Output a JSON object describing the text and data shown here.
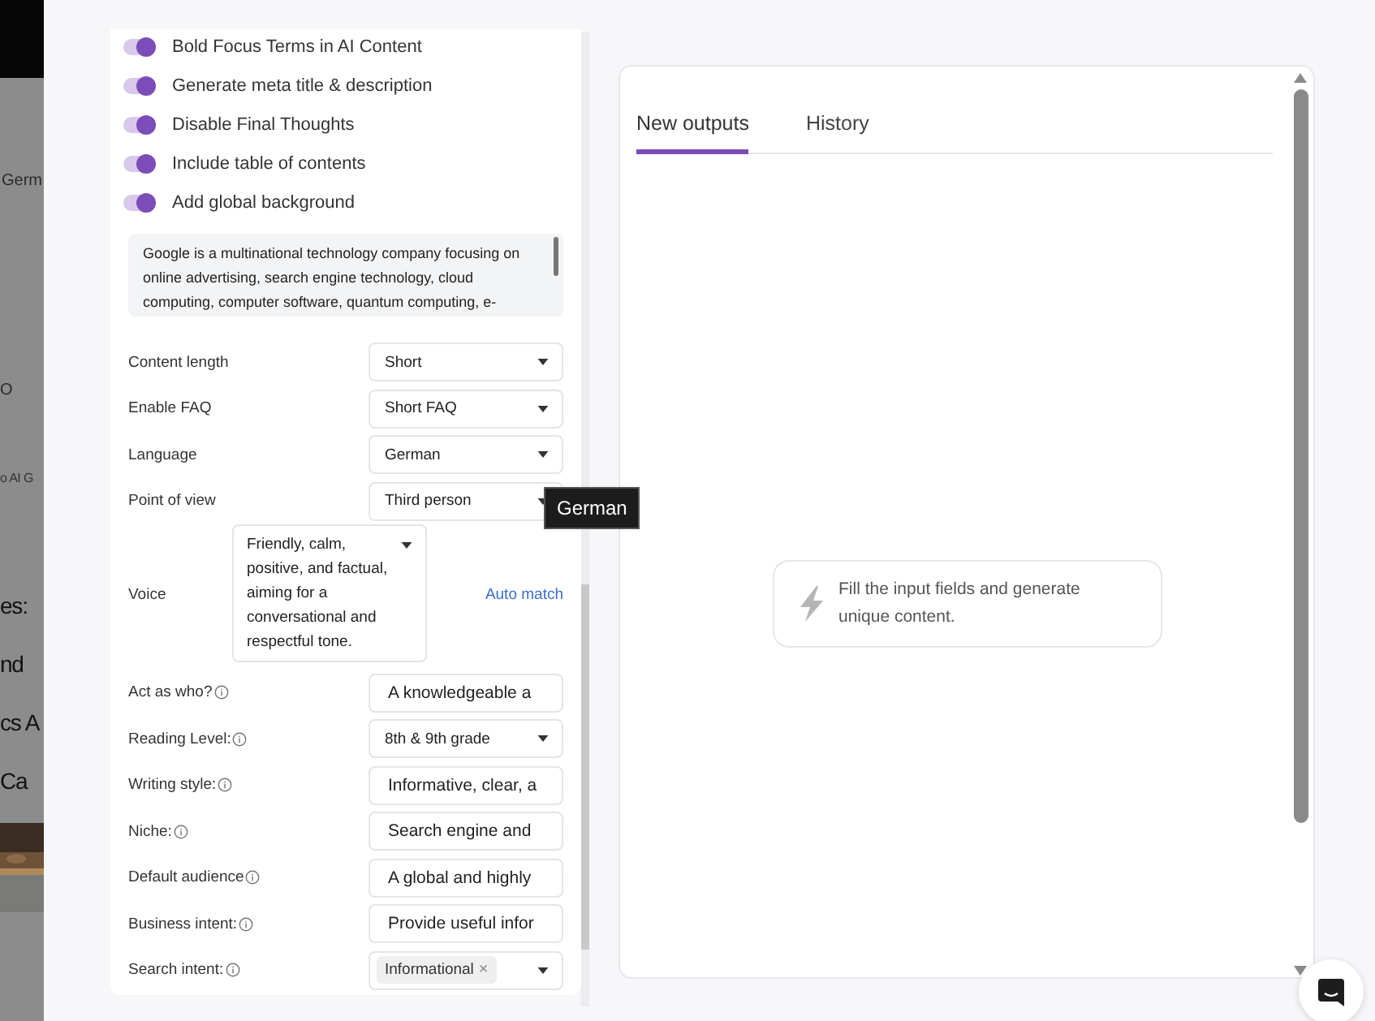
{
  "background_page": {
    "fragments": [
      {
        "kind": "tab",
        "text": "Germ"
      },
      {
        "kind": "icon-text",
        "text": "O"
      },
      {
        "kind": "crumb",
        "text": "o AI G"
      },
      {
        "kind": "heading",
        "text": "es:"
      },
      {
        "kind": "heading",
        "text": "nd"
      },
      {
        "kind": "heading",
        "text": "cs A"
      },
      {
        "kind": "heading",
        "text": "Ca"
      }
    ]
  },
  "settings": {
    "toggles": [
      {
        "label": "Bold Focus Terms in AI Content",
        "on": true
      },
      {
        "label": "Generate meta title & description",
        "on": true
      },
      {
        "label": "Disable Final Thoughts",
        "on": true
      },
      {
        "label": "Include table of contents",
        "on": true
      },
      {
        "label": "Add global background",
        "on": true
      }
    ],
    "background_text": "Google is a multinational technology company focusing on online advertising, search engine technology, cloud computing, computer software, quantum computing, e-",
    "fields": [
      {
        "kind": "select",
        "label": "Content length",
        "info": false,
        "value": "Short"
      },
      {
        "kind": "select",
        "label": "Enable FAQ",
        "info": false,
        "value": "Short FAQ"
      },
      {
        "kind": "select",
        "label": "Language",
        "info": false,
        "value": "German"
      },
      {
        "kind": "select",
        "label": "Point of view",
        "info": false,
        "value": "Third person"
      },
      {
        "kind": "voice",
        "label": "Voice",
        "info": false,
        "value": "Friendly, calm, positive, and factual, aiming for a conversational and respectful tone.",
        "link": "Auto match"
      },
      {
        "kind": "input",
        "label": "Act as who?",
        "info": true,
        "value": "A knowledgeable a"
      },
      {
        "kind": "select",
        "label": "Reading Level:",
        "info": true,
        "value": "8th & 9th grade"
      },
      {
        "kind": "input",
        "label": "Writing style:",
        "info": true,
        "value": "Informative, clear, a"
      },
      {
        "kind": "input",
        "label": "Niche:",
        "info": true,
        "value": "Search engine and"
      },
      {
        "kind": "input",
        "label": "Default audience",
        "info": true,
        "value": "A global and highly"
      },
      {
        "kind": "input",
        "label": "Business intent:",
        "info": true,
        "value": "Provide useful infor"
      },
      {
        "kind": "tags",
        "label": "Search intent:",
        "info": true,
        "tags": [
          "Informational"
        ],
        "remove": "×"
      }
    ]
  },
  "tooltip": "German",
  "output": {
    "tabs": [
      {
        "label": "New outputs",
        "selected": true
      },
      {
        "label": "History",
        "selected": false
      }
    ],
    "empty_message": "Fill the input fields and generate unique content."
  }
}
